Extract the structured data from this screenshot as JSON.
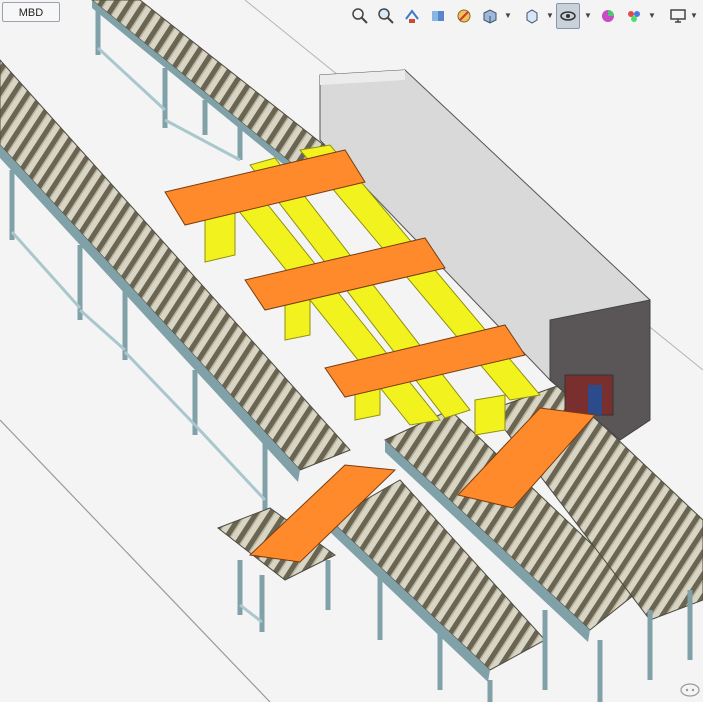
{
  "tabs": {
    "mbd_label": "MBD"
  },
  "toolbar": {
    "buttons": [
      {
        "name": "zoom-to-fit-icon"
      },
      {
        "name": "zoom-to-area-icon"
      },
      {
        "name": "previous-view-icon"
      },
      {
        "name": "section-view-icon"
      },
      {
        "name": "dynamic-annotation-icon"
      },
      {
        "name": "view-orientation-icon"
      },
      {
        "name": "display-style-icon"
      },
      {
        "name": "hide-show-items-icon"
      },
      {
        "name": "edit-appearance-icon"
      },
      {
        "name": "apply-scene-icon"
      },
      {
        "name": "view-settings-icon"
      }
    ]
  },
  "colors": {
    "background": "#f4f4f4",
    "panel_orange": "#ff8a2b",
    "beam_yellow": "#f2f21e",
    "frame_teal": "#9fc1c6",
    "roller_dark": "#5e5a4c",
    "machine_gray": "#d6d6d6"
  }
}
